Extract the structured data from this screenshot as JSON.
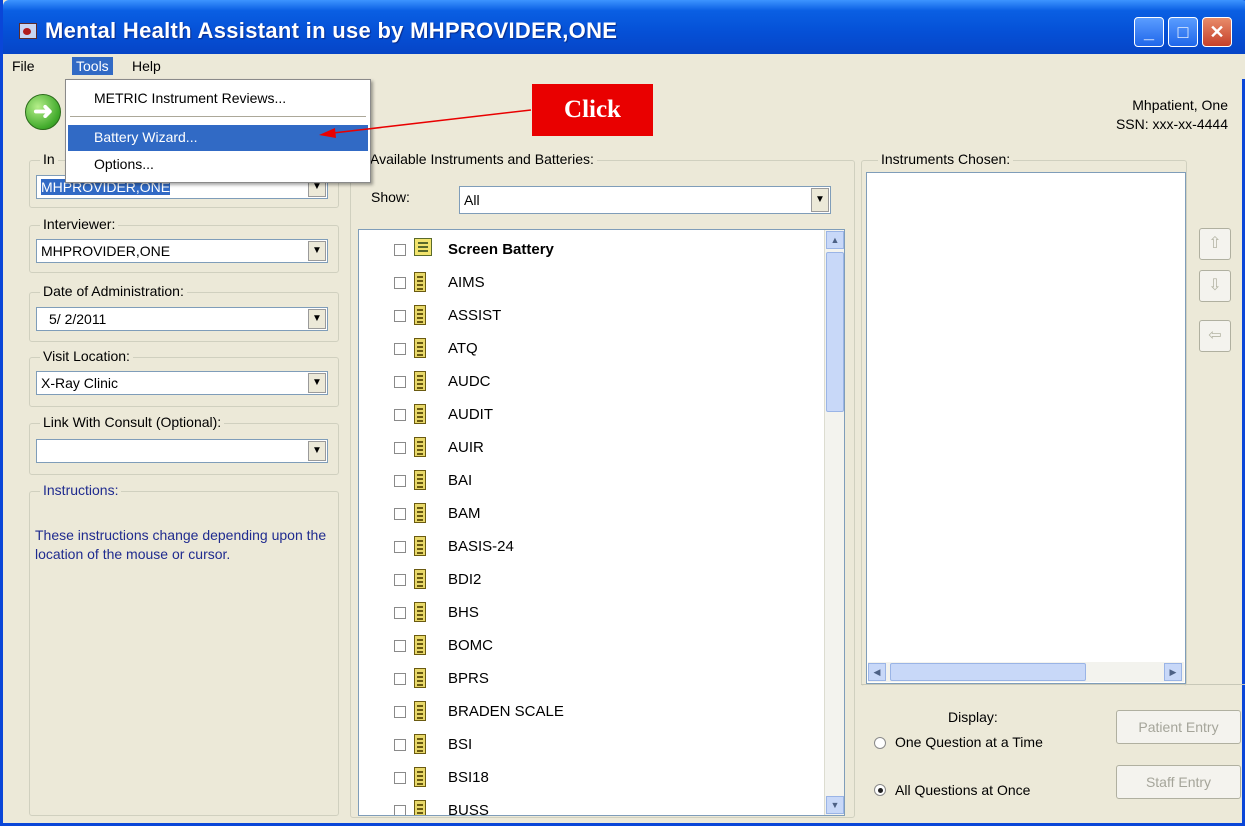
{
  "window": {
    "title": "Mental Health Assistant in use by MHPROVIDER,ONE",
    "buttons": {
      "minimize": "_",
      "maximize": "□",
      "close": "✕"
    }
  },
  "menubar": {
    "file": "File",
    "tools": "Tools",
    "help": "Help"
  },
  "tools_menu": {
    "items": [
      "METRIC Instrument Reviews...",
      "Battery Wizard...",
      "Options..."
    ],
    "highlighted": "Battery Wizard..."
  },
  "callout": {
    "text": "Click",
    "color": "#e90000"
  },
  "patient": {
    "name": "Mhpatient, One",
    "ssn": "SSN: xxx-xx-4444"
  },
  "left_panel": {
    "instructor_label": "In",
    "instructor_value": "MHPROVIDER,ONE",
    "interviewer_label": "Interviewer:",
    "interviewer_value": "MHPROVIDER,ONE",
    "date_label": "Date of Administration:",
    "date_value": "5/ 2/2011",
    "location_label": "Visit Location:",
    "location_value": "X-Ray Clinic",
    "consult_label": "Link With Consult (Optional):",
    "consult_value": "",
    "instructions_label": "Instructions:",
    "instructions_text": "These instructions change depending upon the location of the mouse or cursor."
  },
  "available": {
    "label": "Available Instruments and Batteries:",
    "show_label": "Show:",
    "show_value": "All",
    "items": [
      "Screen Battery",
      "AIMS",
      "ASSIST",
      "ATQ",
      "AUDC",
      "AUDIT",
      "AUIR",
      "BAI",
      "BAM",
      "BASIS-24",
      "BDI2",
      "BHS",
      "BOMC",
      "BPRS",
      "BRADEN SCALE",
      "BSI",
      "BSI18",
      "BUSS"
    ]
  },
  "chosen": {
    "label": "Instruments Chosen:"
  },
  "display": {
    "label": "Display:",
    "option_one": "One Question at a Time",
    "option_all": "All Questions at Once",
    "selected": "All Questions at Once"
  },
  "buttons": {
    "patient_entry": "Patient Entry",
    "staff_entry": "Staff Entry"
  },
  "colors": {
    "titlebar": "#0550d6",
    "highlight": "#316ac5",
    "instructions_text": "#1f2b8f"
  }
}
